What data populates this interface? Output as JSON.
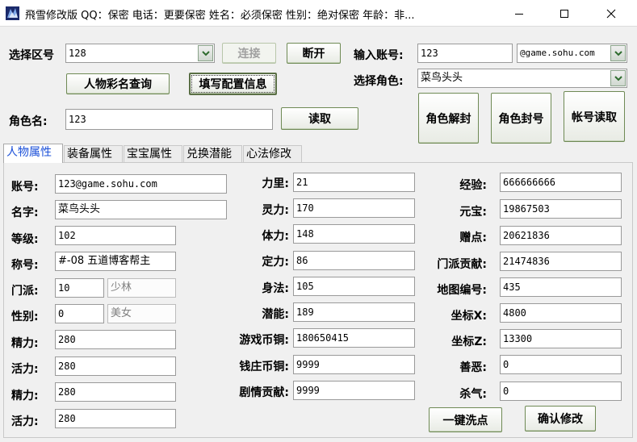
{
  "window": {
    "title": "飛雪修改版 QQ：保密 电话：更要保密 姓名：必须保密 性别：绝对保密 年龄：非..."
  },
  "top": {
    "region_label": "选择区号",
    "region_value": "128",
    "connect_label": "连接",
    "disconnect_label": "断开",
    "account_label": "输入账号:",
    "account_value": "123",
    "domain_value": "@game.sohu.com",
    "role_select_label": "选择角色:",
    "role_select_value": "菜鸟头头",
    "query_button": "人物彩名查询",
    "fill_button": "填写配置信息",
    "role_name_label": "角色名:",
    "role_name_value": "123",
    "read_button": "读取",
    "unseal_button": "角色解封",
    "seal_button": "角色封号",
    "account_read_button": "帐号读取"
  },
  "tabs": [
    {
      "label": "人物属性",
      "active": true
    },
    {
      "label": "装备属性",
      "active": false
    },
    {
      "label": "宝宝属性",
      "active": false
    },
    {
      "label": "兑换潜能",
      "active": false
    },
    {
      "label": "心法修改",
      "active": false
    }
  ],
  "attributes": {
    "col1": [
      {
        "label": "账号:",
        "value": "123@game.sohu.com"
      },
      {
        "label": "名字:",
        "value": "菜鸟头头"
      },
      {
        "label": "等级:",
        "value": "102"
      },
      {
        "label": "称号:",
        "value": "#-08 五道博客帮主"
      },
      {
        "label": "门派:",
        "value": "10",
        "extra": "少林"
      },
      {
        "label": "性别:",
        "value": "0",
        "extra": "美女"
      },
      {
        "label": "精力:",
        "value": "280"
      },
      {
        "label": "活力:",
        "value": "280"
      },
      {
        "label": "精力:",
        "value": "280"
      },
      {
        "label": "活力:",
        "value": "280"
      }
    ],
    "col2": [
      {
        "label": "力里:",
        "value": "21"
      },
      {
        "label": "灵力:",
        "value": "170"
      },
      {
        "label": "体力:",
        "value": "148"
      },
      {
        "label": "定力:",
        "value": "86"
      },
      {
        "label": "身法:",
        "value": "105"
      },
      {
        "label": "潜能:",
        "value": "189"
      },
      {
        "label": "游戏币铜:",
        "value": "180650415"
      },
      {
        "label": "钱庄币铜:",
        "value": "9999"
      },
      {
        "label": "剧情贡献:",
        "value": "9999"
      }
    ],
    "col3": [
      {
        "label": "经验:",
        "value": "666666666"
      },
      {
        "label": "元宝:",
        "value": "19867503"
      },
      {
        "label": "赠点:",
        "value": "20621836"
      },
      {
        "label": "门派贡献:",
        "value": "21474836"
      },
      {
        "label": "地图编号:",
        "value": "435"
      },
      {
        "label": "坐标X:",
        "value": "4800"
      },
      {
        "label": "坐标Z:",
        "value": "13300"
      },
      {
        "label": "善恶:",
        "value": "0"
      },
      {
        "label": "杀气:",
        "value": "0"
      }
    ]
  },
  "actions": {
    "wash_button": "一键洗点",
    "confirm_button": "确认修改"
  }
}
